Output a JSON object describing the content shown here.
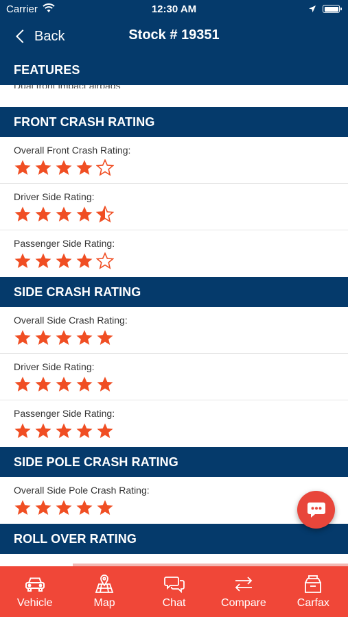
{
  "status_bar": {
    "carrier": "Carrier",
    "time": "12:30 AM"
  },
  "nav": {
    "back_label": "Back",
    "title": "Stock # 19351"
  },
  "features": {
    "heading": "FEATURES",
    "clipped_text": "Dual front impact airbags"
  },
  "colors": {
    "navy": "#053a6b",
    "star": "#f04e23",
    "tabbar": "#f04738"
  },
  "sections": [
    {
      "heading": "FRONT CRASH RATING",
      "rows": [
        {
          "label": "Overall Front Crash Rating:",
          "stars": 4,
          "max": 5
        },
        {
          "label": "Driver Side Rating:",
          "stars": 4.5,
          "max": 5
        },
        {
          "label": "Passenger Side Rating:",
          "stars": 4,
          "max": 5
        }
      ]
    },
    {
      "heading": "SIDE CRASH RATING",
      "rows": [
        {
          "label": "Overall Side Crash Rating:",
          "stars": 5,
          "max": 5
        },
        {
          "label": "Driver Side Rating:",
          "stars": 5,
          "max": 5
        },
        {
          "label": "Passenger Side Rating:",
          "stars": 5,
          "max": 5
        }
      ]
    },
    {
      "heading": "SIDE POLE CRASH RATING",
      "rows": [
        {
          "label": "Overall Side Pole Crash Rating:",
          "stars": 5,
          "max": 5
        }
      ]
    },
    {
      "heading": "ROLL OVER RATING",
      "rows": []
    }
  ],
  "chat_button": {
    "icon": "chat-bubble-icon"
  },
  "page_progress": 0.21,
  "tabs": [
    {
      "label": "Vehicle",
      "icon": "car-icon"
    },
    {
      "label": "Map",
      "icon": "map-icon"
    },
    {
      "label": "Chat",
      "icon": "chat-icon"
    },
    {
      "label": "Compare",
      "icon": "compare-arrows-icon"
    },
    {
      "label": "Carfax",
      "icon": "carfax-box-icon"
    }
  ]
}
